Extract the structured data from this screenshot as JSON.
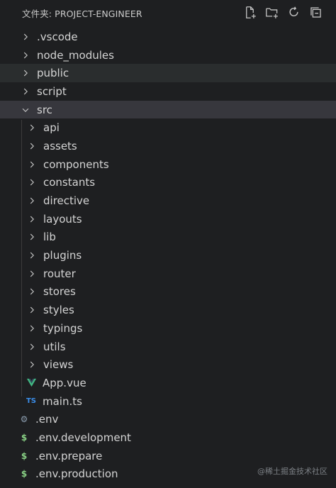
{
  "explorer": {
    "title": "文件夹: PROJECT-ENGINEER",
    "actions": [
      {
        "name": "new-file-icon"
      },
      {
        "name": "new-folder-icon"
      },
      {
        "name": "refresh-icon"
      },
      {
        "name": "collapse-all-icon"
      }
    ]
  },
  "tree": [
    {
      "label": ".vscode",
      "kind": "folder",
      "open": false,
      "depth": 0
    },
    {
      "label": "node_modules",
      "kind": "folder",
      "open": false,
      "depth": 0
    },
    {
      "label": "public",
      "kind": "folder",
      "open": false,
      "depth": 0,
      "state": "hover"
    },
    {
      "label": "script",
      "kind": "folder",
      "open": false,
      "depth": 0
    },
    {
      "label": "src",
      "kind": "folder",
      "open": true,
      "depth": 0,
      "state": "selected"
    },
    {
      "label": "api",
      "kind": "folder",
      "open": false,
      "depth": 1
    },
    {
      "label": "assets",
      "kind": "folder",
      "open": false,
      "depth": 1
    },
    {
      "label": "components",
      "kind": "folder",
      "open": false,
      "depth": 1
    },
    {
      "label": "constants",
      "kind": "folder",
      "open": false,
      "depth": 1
    },
    {
      "label": "directive",
      "kind": "folder",
      "open": false,
      "depth": 1
    },
    {
      "label": "layouts",
      "kind": "folder",
      "open": false,
      "depth": 1
    },
    {
      "label": "lib",
      "kind": "folder",
      "open": false,
      "depth": 1
    },
    {
      "label": "plugins",
      "kind": "folder",
      "open": false,
      "depth": 1
    },
    {
      "label": "router",
      "kind": "folder",
      "open": false,
      "depth": 1
    },
    {
      "label": "stores",
      "kind": "folder",
      "open": false,
      "depth": 1
    },
    {
      "label": "styles",
      "kind": "folder",
      "open": false,
      "depth": 1
    },
    {
      "label": "typings",
      "kind": "folder",
      "open": false,
      "depth": 1
    },
    {
      "label": "utils",
      "kind": "folder",
      "open": false,
      "depth": 1
    },
    {
      "label": "views",
      "kind": "folder",
      "open": false,
      "depth": 1
    },
    {
      "label": "App.vue",
      "kind": "file",
      "icon": "vue-icon",
      "glyph": "V",
      "color": "#41b883",
      "depth": 1
    },
    {
      "label": "main.ts",
      "kind": "file",
      "icon": "typescript-icon",
      "glyph": "TS",
      "color": "#3b8eea",
      "depth": 1
    },
    {
      "label": ".env",
      "kind": "file",
      "icon": "gear-icon",
      "glyph": "⚙",
      "color": "#8d9fb1",
      "depth": 0
    },
    {
      "label": ".env.development",
      "kind": "file",
      "icon": "dollar-icon",
      "glyph": "$",
      "color": "#89d185",
      "depth": 0
    },
    {
      "label": ".env.prepare",
      "kind": "file",
      "icon": "dollar-icon",
      "glyph": "$",
      "color": "#89d185",
      "depth": 0
    },
    {
      "label": ".env.production",
      "kind": "file",
      "icon": "dollar-icon",
      "glyph": "$",
      "color": "#89d185",
      "depth": 0
    }
  ],
  "watermark": "@稀土掘金技术社区",
  "colors": {
    "background": "#1e1f21",
    "selected": "#37373d",
    "hover": "#2a2d2e",
    "text": "#d4d4d4"
  }
}
